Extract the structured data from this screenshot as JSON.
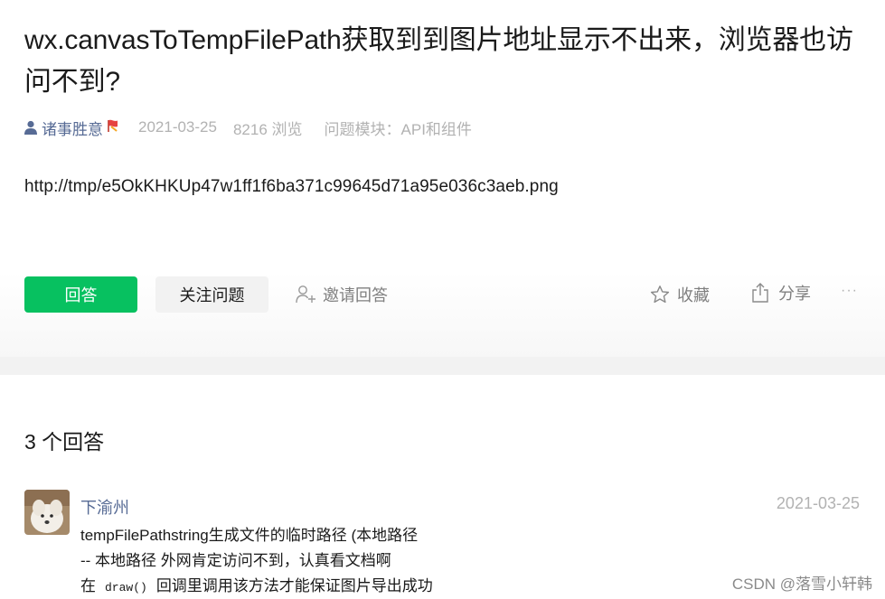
{
  "question": {
    "title": "wx.canvasToTempFilePath获取到到图片地址显示不出来，浏览器也访问不到?",
    "author": "诸事胜意",
    "date": "2021-03-25",
    "views": "8216 浏览",
    "module_label": "问题模块：",
    "module_value": "API和组件",
    "body": "http://tmp/e5OkKHKUp47w1ff1f6ba371c99645d71a95e036c3aeb.png"
  },
  "actions": {
    "answer_label": "回答",
    "follow_label": "关注问题",
    "invite_label": "邀请回答",
    "favorite_label": "收藏",
    "share_label": "分享",
    "more_label": "···"
  },
  "answers": {
    "count_label": "3 个回答",
    "items": [
      {
        "name": "下渝州",
        "date": "2021-03-25",
        "line1": "tempFilePathstring生成文件的临时路径 (本地路径",
        "line2": "-- 本地路径 外网肯定访问不到，认真看文档啊",
        "line3_pre": "在",
        "line3_code": "draw()",
        "line3_post": "回调里调用该方法才能保证图片导出成功"
      }
    ]
  },
  "watermark": "CSDN @落雪小轩韩",
  "colors": {
    "accent": "#07c160",
    "link": "#576b95",
    "muted": "#b2b2b2"
  },
  "icons": [
    "user-icon",
    "flag-icon",
    "invite-user-icon",
    "star-icon",
    "share-icon",
    "more-icon"
  ]
}
